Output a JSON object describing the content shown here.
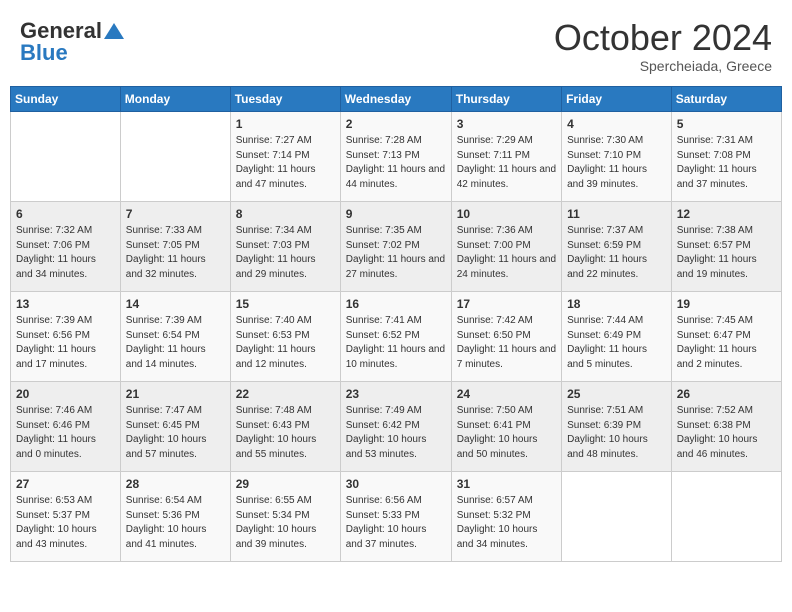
{
  "header": {
    "logo_general": "General",
    "logo_blue": "Blue",
    "month": "October 2024",
    "location": "Spercheiada, Greece"
  },
  "weekdays": [
    "Sunday",
    "Monday",
    "Tuesday",
    "Wednesday",
    "Thursday",
    "Friday",
    "Saturday"
  ],
  "weeks": [
    [
      {
        "day": "",
        "info": ""
      },
      {
        "day": "",
        "info": ""
      },
      {
        "day": "1",
        "info": "Sunrise: 7:27 AM\nSunset: 7:14 PM\nDaylight: 11 hours and 47 minutes."
      },
      {
        "day": "2",
        "info": "Sunrise: 7:28 AM\nSunset: 7:13 PM\nDaylight: 11 hours and 44 minutes."
      },
      {
        "day": "3",
        "info": "Sunrise: 7:29 AM\nSunset: 7:11 PM\nDaylight: 11 hours and 42 minutes."
      },
      {
        "day": "4",
        "info": "Sunrise: 7:30 AM\nSunset: 7:10 PM\nDaylight: 11 hours and 39 minutes."
      },
      {
        "day": "5",
        "info": "Sunrise: 7:31 AM\nSunset: 7:08 PM\nDaylight: 11 hours and 37 minutes."
      }
    ],
    [
      {
        "day": "6",
        "info": "Sunrise: 7:32 AM\nSunset: 7:06 PM\nDaylight: 11 hours and 34 minutes."
      },
      {
        "day": "7",
        "info": "Sunrise: 7:33 AM\nSunset: 7:05 PM\nDaylight: 11 hours and 32 minutes."
      },
      {
        "day": "8",
        "info": "Sunrise: 7:34 AM\nSunset: 7:03 PM\nDaylight: 11 hours and 29 minutes."
      },
      {
        "day": "9",
        "info": "Sunrise: 7:35 AM\nSunset: 7:02 PM\nDaylight: 11 hours and 27 minutes."
      },
      {
        "day": "10",
        "info": "Sunrise: 7:36 AM\nSunset: 7:00 PM\nDaylight: 11 hours and 24 minutes."
      },
      {
        "day": "11",
        "info": "Sunrise: 7:37 AM\nSunset: 6:59 PM\nDaylight: 11 hours and 22 minutes."
      },
      {
        "day": "12",
        "info": "Sunrise: 7:38 AM\nSunset: 6:57 PM\nDaylight: 11 hours and 19 minutes."
      }
    ],
    [
      {
        "day": "13",
        "info": "Sunrise: 7:39 AM\nSunset: 6:56 PM\nDaylight: 11 hours and 17 minutes."
      },
      {
        "day": "14",
        "info": "Sunrise: 7:39 AM\nSunset: 6:54 PM\nDaylight: 11 hours and 14 minutes."
      },
      {
        "day": "15",
        "info": "Sunrise: 7:40 AM\nSunset: 6:53 PM\nDaylight: 11 hours and 12 minutes."
      },
      {
        "day": "16",
        "info": "Sunrise: 7:41 AM\nSunset: 6:52 PM\nDaylight: 11 hours and 10 minutes."
      },
      {
        "day": "17",
        "info": "Sunrise: 7:42 AM\nSunset: 6:50 PM\nDaylight: 11 hours and 7 minutes."
      },
      {
        "day": "18",
        "info": "Sunrise: 7:44 AM\nSunset: 6:49 PM\nDaylight: 11 hours and 5 minutes."
      },
      {
        "day": "19",
        "info": "Sunrise: 7:45 AM\nSunset: 6:47 PM\nDaylight: 11 hours and 2 minutes."
      }
    ],
    [
      {
        "day": "20",
        "info": "Sunrise: 7:46 AM\nSunset: 6:46 PM\nDaylight: 11 hours and 0 minutes."
      },
      {
        "day": "21",
        "info": "Sunrise: 7:47 AM\nSunset: 6:45 PM\nDaylight: 10 hours and 57 minutes."
      },
      {
        "day": "22",
        "info": "Sunrise: 7:48 AM\nSunset: 6:43 PM\nDaylight: 10 hours and 55 minutes."
      },
      {
        "day": "23",
        "info": "Sunrise: 7:49 AM\nSunset: 6:42 PM\nDaylight: 10 hours and 53 minutes."
      },
      {
        "day": "24",
        "info": "Sunrise: 7:50 AM\nSunset: 6:41 PM\nDaylight: 10 hours and 50 minutes."
      },
      {
        "day": "25",
        "info": "Sunrise: 7:51 AM\nSunset: 6:39 PM\nDaylight: 10 hours and 48 minutes."
      },
      {
        "day": "26",
        "info": "Sunrise: 7:52 AM\nSunset: 6:38 PM\nDaylight: 10 hours and 46 minutes."
      }
    ],
    [
      {
        "day": "27",
        "info": "Sunrise: 6:53 AM\nSunset: 5:37 PM\nDaylight: 10 hours and 43 minutes."
      },
      {
        "day": "28",
        "info": "Sunrise: 6:54 AM\nSunset: 5:36 PM\nDaylight: 10 hours and 41 minutes."
      },
      {
        "day": "29",
        "info": "Sunrise: 6:55 AM\nSunset: 5:34 PM\nDaylight: 10 hours and 39 minutes."
      },
      {
        "day": "30",
        "info": "Sunrise: 6:56 AM\nSunset: 5:33 PM\nDaylight: 10 hours and 37 minutes."
      },
      {
        "day": "31",
        "info": "Sunrise: 6:57 AM\nSunset: 5:32 PM\nDaylight: 10 hours and 34 minutes."
      },
      {
        "day": "",
        "info": ""
      },
      {
        "day": "",
        "info": ""
      }
    ]
  ]
}
